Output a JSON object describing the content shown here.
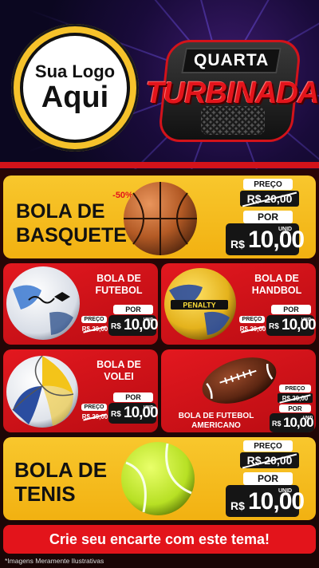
{
  "logo": {
    "line1": "Sua Logo",
    "line2": "Aqui"
  },
  "badge": {
    "line1": "QUARTA",
    "line2": "TURBINADA"
  },
  "colors": {
    "accent_red": "#e3141b",
    "accent_yellow": "#f6c22b",
    "dark": "#151515"
  },
  "products": {
    "basquete": {
      "title1": "BOLA DE",
      "title2": "BASQUETE",
      "discount": "-50%",
      "price_label": "PREÇO",
      "old_price": "R$ 20,00",
      "por_label": "POR",
      "currency": "R$",
      "price": "10,00",
      "unit": "UNID",
      "icon": "basketball-icon"
    },
    "futebol": {
      "title1": "BOLA DE",
      "title2": "FUTEBOL",
      "price_label": "PREÇO",
      "old_price": "R$ 20,00",
      "por_label": "POR",
      "currency": "R$",
      "price": "10,00",
      "unit": "UNID",
      "icon": "soccer-ball-icon"
    },
    "handbol": {
      "title1": "BOLA DE",
      "title2": "HANDBOL",
      "price_label": "PREÇO",
      "old_price": "R$ 20,00",
      "por_label": "POR",
      "currency": "R$",
      "price": "10,00",
      "unit": "UNID",
      "icon": "handball-icon"
    },
    "volei": {
      "title1": "BOLA DE",
      "title2": "VOLEI",
      "price_label": "PREÇO",
      "old_price": "R$ 20,00",
      "por_label": "POR",
      "currency": "R$",
      "price": "10,00",
      "unit": "UNID",
      "icon": "volleyball-icon"
    },
    "americano": {
      "title1": "BOLA DE FUTEBOL",
      "title2": "AMERICANO",
      "price_label": "PREÇO",
      "old_price": "R$ 20,00",
      "por_label": "POR",
      "currency": "R$",
      "price": "10,00",
      "unit": "UNID",
      "icon": "american-football-icon"
    },
    "tenis": {
      "title1": "BOLA DE",
      "title2": "TENIS",
      "price_label": "PREÇO",
      "old_price": "R$ 20,00",
      "por_label": "POR",
      "currency": "R$",
      "price": "10,00",
      "unit": "UNID",
      "icon": "tennis-ball-icon"
    }
  },
  "footer": {
    "cta": "Crie seu encarte com este tema!",
    "disclaimer": "*Imagens Meramente Ilustrativas"
  }
}
